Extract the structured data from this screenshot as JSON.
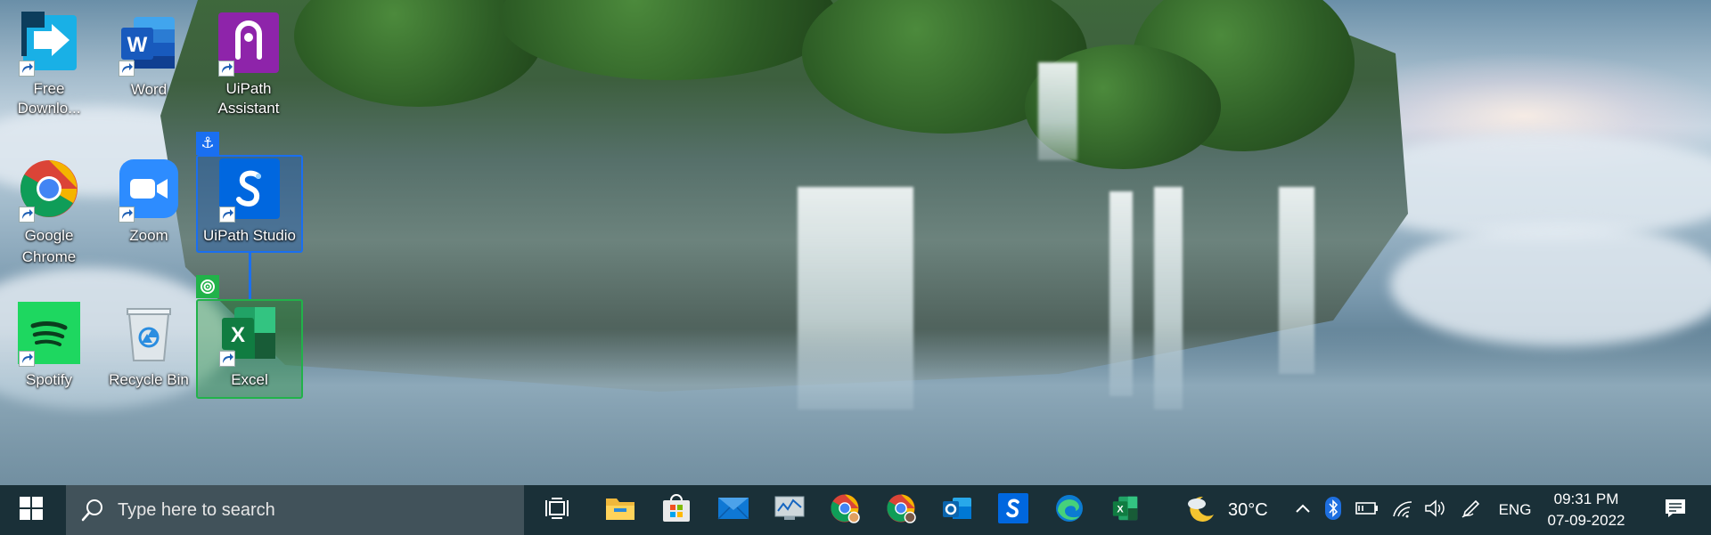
{
  "desktop": {
    "icons": [
      {
        "label": "Free\nDownlo...",
        "icon": "free-download-manager-icon"
      },
      {
        "label": "Word",
        "icon": "word-icon"
      },
      {
        "label": "UiPath\nAssistant",
        "icon": "uipath-assistant-icon"
      },
      {
        "label": "Google\nChrome",
        "icon": "chrome-icon"
      },
      {
        "label": "Zoom",
        "icon": "zoom-icon"
      },
      {
        "label": "UiPath Studio",
        "icon": "uipath-studio-icon"
      },
      {
        "label": "Spotify",
        "icon": "spotify-icon"
      },
      {
        "label": "Recycle Bin",
        "icon": "recycle-bin-icon"
      },
      {
        "label": "Excel",
        "icon": "excel-icon"
      }
    ]
  },
  "taskbar": {
    "search_placeholder": "Type here to search",
    "pinned_apps": [
      "task-view-icon",
      "file-explorer-icon",
      "microsoft-store-icon",
      "mail-icon",
      "performance-monitor-icon",
      "chrome-profile-1-icon",
      "chrome-profile-2-icon",
      "outlook-icon",
      "uipath-studio-taskbar-icon",
      "edge-icon",
      "excel-taskbar-icon"
    ],
    "weather": {
      "temperature": "30°C",
      "icon": "weather-moon-cloud-icon"
    },
    "language": "ENG",
    "time": "09:31 PM",
    "date": "07-09-2022"
  },
  "colors": {
    "taskbar_bg": "#1a3038",
    "search_bg": "#41525a",
    "selection_blue": "#1a6ff0",
    "selection_green": "#21b24a"
  }
}
